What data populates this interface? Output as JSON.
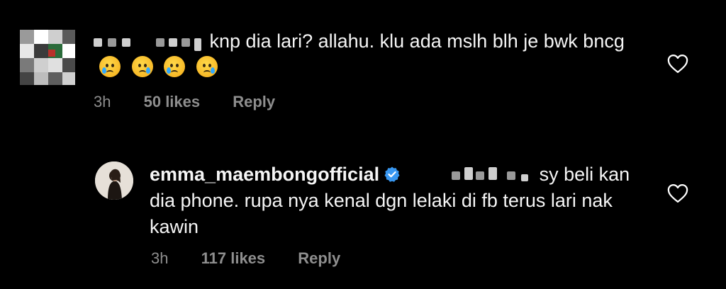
{
  "comments": [
    {
      "username": "",
      "text": "knp dia lari? allahu. klu ada mslh blh je bwk bncg",
      "emoji_count": 4,
      "time": "3h",
      "likes": "50 likes",
      "reply": "Reply"
    },
    {
      "username": "emma_maembongofficial",
      "verified": true,
      "text": "sy beli kan dia phone. rupa nya kenal dgn lelaki di fb terus lari nak kawin",
      "time": "3h",
      "likes": "117 likes",
      "reply": "Reply"
    }
  ],
  "colors": {
    "background": "#000000",
    "text": "#f5f5f5",
    "muted": "#8e8e8e",
    "verified": "#3897f0"
  },
  "icons": {
    "like": "heart-outline-icon",
    "verified": "verified-badge-icon",
    "emoji": "crying-face-emoji"
  }
}
